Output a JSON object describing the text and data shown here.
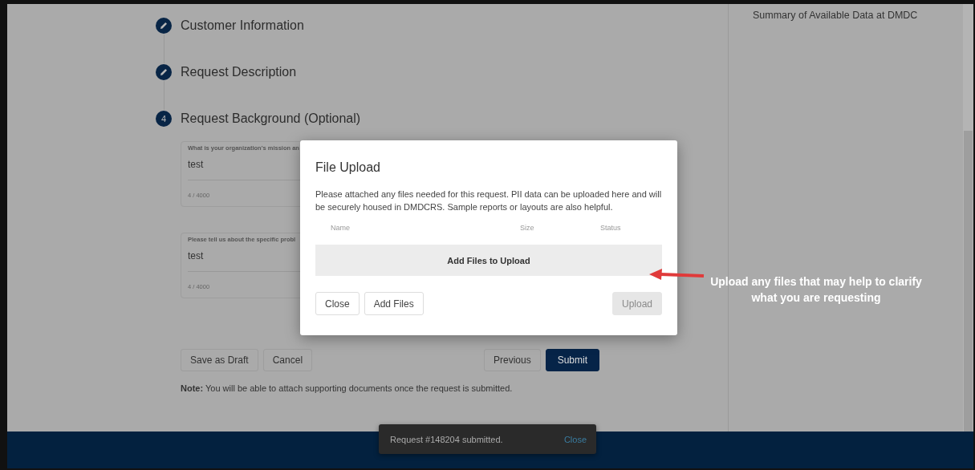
{
  "steps": [
    {
      "kind": "done",
      "label": "Customer Information"
    },
    {
      "kind": "done",
      "label": "Request Description"
    },
    {
      "kind": "number",
      "number": "4",
      "label": "Request Background (Optional)"
    }
  ],
  "fields": [
    {
      "label": "What is your organization's mission an",
      "value": "test",
      "counter": "4 / 4000"
    },
    {
      "label": "Please tell us about the specific probl",
      "value": "test",
      "counter": "4 / 4000"
    }
  ],
  "form_buttons": [
    {
      "label": "Save as Draft",
      "primary": false
    },
    {
      "label": "Cancel",
      "primary": false
    }
  ],
  "nav_buttons": [
    {
      "label": "Previous",
      "primary": false
    },
    {
      "label": "Submit",
      "primary": true
    }
  ],
  "note": "**Note:**  You will be able to attach supporting documents once the request is submitted.",
  "sidebar": {
    "title": "Summary of Available Data at DMDC"
  },
  "dialog": {
    "title": "File Upload",
    "description": "Please attached any files needed for this request. PII data can be uploaded here and will be securely housed in DMDCRS. Sample reports or layouts are also helpful.",
    "columns": [
      "Name",
      "Size",
      "Status"
    ],
    "dropzone": "Add Files to Upload",
    "buttons": [
      {
        "label": "Close"
      },
      {
        "label": "Add Files"
      }
    ],
    "upload_button": {
      "label": "Upload",
      "disabled": true
    }
  },
  "annotation": "Upload any files that may help to clarify what you are requesting",
  "snackbar": {
    "message": "Request #148204 submitted.",
    "action": "Close"
  }
}
